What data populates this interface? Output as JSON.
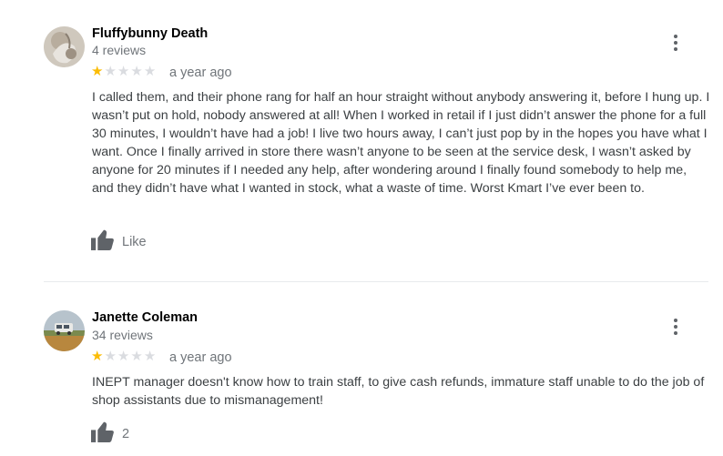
{
  "reviews": [
    {
      "name": "Fluffybunny Death",
      "reviews_count": "4 reviews",
      "rating": 1,
      "max_rating": 5,
      "date": "a year ago",
      "text": "I called them, and their phone rang for half an hour straight without anybody answering it, before I hung up. I wasn’t put on hold, nobody answered at all! When I worked in retail if I just didn’t answer the phone for a full 30 minutes, I wouldn’t have had a job! I live two hours away, I can’t just pop by in the hopes you have what I want. Once I finally arrived in store there wasn’t anyone to be seen at the service desk, I wasn’t asked by anyone for 20 minutes if I needed any help, after wondering around I finally found somebody to help me, and they didn’t have what I wanted in stock, what a waste of time. Worst Kmart I’ve ever been to.",
      "like_label": "Like",
      "avatar_icon": "profile-photo"
    },
    {
      "name": "Janette Coleman",
      "reviews_count": "34 reviews",
      "rating": 1,
      "max_rating": 5,
      "date": "a year ago",
      "text": "INEPT manager doesn't know how to train staff, to give cash refunds, immature staff unable to do the job of shop assistants  due to mismanagement!",
      "like_label": "2",
      "avatar_icon": "profile-photo"
    }
  ],
  "colors": {
    "star_filled": "#fbbc04",
    "star_empty": "#dadce0",
    "secondary_text": "#70757a",
    "divider": "#e8eaed"
  }
}
